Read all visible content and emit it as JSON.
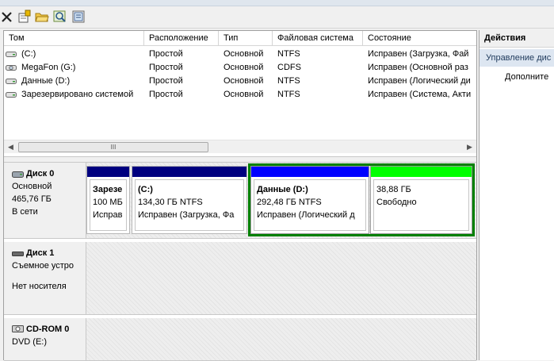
{
  "toolbar": {
    "buttons": [
      "close-icon",
      "properties-icon",
      "open-folder-icon",
      "search-icon",
      "help-icon"
    ]
  },
  "volume_list": {
    "columns": [
      "Том",
      "Расположение",
      "Тип",
      "Файловая система",
      "Состояние"
    ],
    "rows": [
      {
        "volume": "(C:)",
        "layout": "Простой",
        "type": "Основной",
        "fs": "NTFS",
        "status": "Исправен (Загрузка, Фай"
      },
      {
        "volume": "MegaFon (G:)",
        "layout": "Простой",
        "type": "Основной",
        "fs": "CDFS",
        "status": "Исправен (Основной раз"
      },
      {
        "volume": "Данные (D:)",
        "layout": "Простой",
        "type": "Основной",
        "fs": "NTFS",
        "status": "Исправен (Логический ди"
      },
      {
        "volume": "Зарезервировано системой",
        "layout": "Простой",
        "type": "Основной",
        "fs": "NTFS",
        "status": "Исправен (Система, Акти"
      }
    ],
    "scroll_thumb": "III"
  },
  "disks": {
    "disk0": {
      "name": "Диск 0",
      "type": "Основной",
      "size": "465,76 ГБ",
      "status": "В сети",
      "partitions": [
        {
          "name": "Зарезе",
          "size": "100 МБ",
          "status": "Исправ",
          "bar_color": "#00007f"
        },
        {
          "name": "(C:)",
          "size": "134,30 ГБ NTFS",
          "status": "Исправен (Загрузка, Фа",
          "bar_color": "#00007f"
        },
        {
          "name": "Данные  (D:)",
          "size": "292,48 ГБ NTFS",
          "status": "Исправен (Логический д",
          "bar_color": "#0000ff"
        },
        {
          "name": "",
          "size": "38,88 ГБ",
          "status": "Свободно",
          "bar_color": "#00ff00"
        }
      ]
    },
    "disk1": {
      "name": "Диск 1",
      "type": "Съемное устро",
      "status": "Нет носителя"
    },
    "cdrom0": {
      "name": "CD-ROM 0",
      "drive": "DVD (E:)"
    }
  },
  "actions": {
    "title": "Действия",
    "section": "Управление дис",
    "item": "Дополните"
  },
  "colors": {
    "primary_partition": "#00007f",
    "logical_drive": "#0000ff",
    "free_space": "#00ff00",
    "selected_border": "#008000"
  }
}
